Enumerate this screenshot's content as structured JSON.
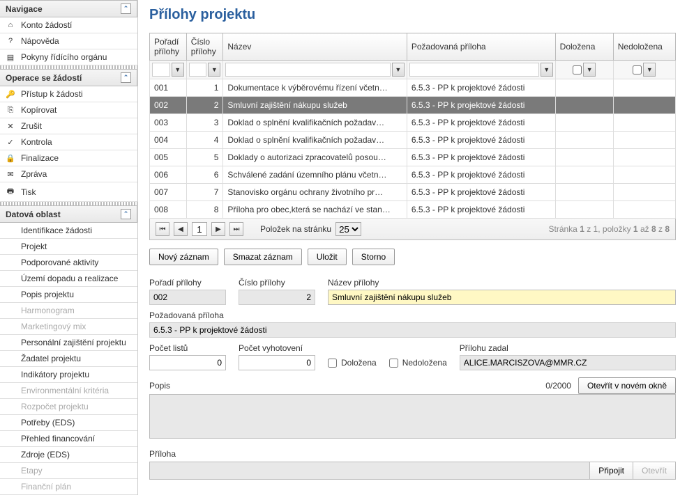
{
  "nav": {
    "sections": [
      {
        "title": "Navigace",
        "items": [
          {
            "icon": "⌂",
            "label": "Konto žádostí"
          },
          {
            "icon": "?",
            "label": "Nápověda"
          },
          {
            "icon": "▤",
            "label": "Pokyny řídícího orgánu"
          }
        ]
      },
      {
        "title": "Operace se žádostí",
        "items": [
          {
            "icon": "🔑",
            "label": "Přístup k žádosti"
          },
          {
            "icon": "⎘",
            "label": "Kopírovat"
          },
          {
            "icon": "✕",
            "label": "Zrušit"
          },
          {
            "icon": "✓",
            "label": "Kontrola"
          },
          {
            "icon": "🔒",
            "label": "Finalizace"
          },
          {
            "icon": "✉",
            "label": "Zpráva"
          },
          {
            "icon": "🖶",
            "label": "Tisk"
          }
        ]
      },
      {
        "title": "Datová oblast",
        "items": [
          {
            "icon": "",
            "label": "Identifikace žádosti"
          },
          {
            "icon": "",
            "label": "Projekt"
          },
          {
            "icon": "",
            "label": "Podporované aktivity"
          },
          {
            "icon": "",
            "label": "Území dopadu a realizace"
          },
          {
            "icon": "",
            "label": "Popis projektu"
          },
          {
            "icon": "",
            "label": "Harmonogram",
            "disabled": true
          },
          {
            "icon": "",
            "label": "Marketingový mix",
            "disabled": true
          },
          {
            "icon": "",
            "label": "Personální zajištění projektu"
          },
          {
            "icon": "",
            "label": "Žadatel projektu"
          },
          {
            "icon": "",
            "label": "Indikátory projektu"
          },
          {
            "icon": "",
            "label": "Environmentální kritéria",
            "disabled": true
          },
          {
            "icon": "",
            "label": "Rozpočet projektu",
            "disabled": true
          },
          {
            "icon": "",
            "label": "Potřeby (EDS)"
          },
          {
            "icon": "",
            "label": "Přehled financování"
          },
          {
            "icon": "",
            "label": "Zdroje (EDS)"
          },
          {
            "icon": "",
            "label": "Etapy",
            "disabled": true
          },
          {
            "icon": "",
            "label": "Finanční plán",
            "disabled": true
          }
        ]
      }
    ]
  },
  "page": {
    "title": "Přílohy projektu"
  },
  "grid": {
    "cols": {
      "poradi": "Pořadí přílohy",
      "cislo": "Číslo přílohy",
      "nazev": "Název",
      "pozad": "Požadovaná příloha",
      "dolozena": "Doložena",
      "nedolozena": "Nedoložena"
    },
    "rows": [
      {
        "p": "001",
        "c": "1",
        "n": "Dokumentace k výběrovému řízení včetn…",
        "pz": "6.5.3 - PP k projektové žádosti"
      },
      {
        "p": "002",
        "c": "2",
        "n": "Smluvní zajištění nákupu služeb",
        "pz": "6.5.3 - PP k projektové žádosti",
        "sel": true
      },
      {
        "p": "003",
        "c": "3",
        "n": "Doklad o splnění kvalifikačních požadav…",
        "pz": "6.5.3 - PP k projektové žádosti"
      },
      {
        "p": "004",
        "c": "4",
        "n": "Doklad o splnění kvalifikačních požadav…",
        "pz": "6.5.3 - PP k projektové žádosti"
      },
      {
        "p": "005",
        "c": "5",
        "n": "Doklady o autorizaci zpracovatelů posou…",
        "pz": "6.5.3 - PP k projektové žádosti"
      },
      {
        "p": "006",
        "c": "6",
        "n": "Schválené zadání územního plánu včetn…",
        "pz": "6.5.3 - PP k projektové žádosti"
      },
      {
        "p": "007",
        "c": "7",
        "n": "Stanovisko orgánu ochrany životního pr…",
        "pz": "6.5.3 - PP k projektové žádosti"
      },
      {
        "p": "008",
        "c": "8",
        "n": "Příloha pro obec,která se nachází ve stan…",
        "pz": "6.5.3 - PP k projektové žádosti"
      }
    ]
  },
  "pager": {
    "page": "1",
    "per_label": "Položek na stránku",
    "per_value": "25",
    "info_pre": "Stránka ",
    "info_pg": "1",
    "info_mid": " z 1, položky ",
    "info_a": "1",
    "info_mid2": " až ",
    "info_b": "8",
    "info_mid3": " z ",
    "info_tot": "8"
  },
  "actions": {
    "novy": "Nový záznam",
    "smazat": "Smazat záznam",
    "ulozit": "Uložit",
    "storno": "Storno"
  },
  "form": {
    "poradi_l": "Pořadí přílohy",
    "poradi_v": "002",
    "cislo_l": "Číslo přílohy",
    "cislo_v": "2",
    "nazev_l": "Název přílohy",
    "nazev_v": "Smluvní zajištění nákupu služeb",
    "pozad_l": "Požadovaná příloha",
    "pozad_v": "6.5.3 - PP k projektové žádosti",
    "listu_l": "Počet listů",
    "listu_v": "0",
    "vyhot_l": "Počet vyhotovení",
    "vyhot_v": "0",
    "dolozena_l": "Doložena",
    "nedolozena_l": "Nedoložena",
    "zadal_l": "Přílohu zadal",
    "zadal_v": "ALICE.MARCISZOVA@MMR.CZ",
    "popis_l": "Popis",
    "popis_count": "0/2000",
    "otevrit_okno": "Otevřít v novém okně",
    "priloha_l": "Příloha",
    "pripojit": "Připojit",
    "otevrit": "Otevřít"
  }
}
